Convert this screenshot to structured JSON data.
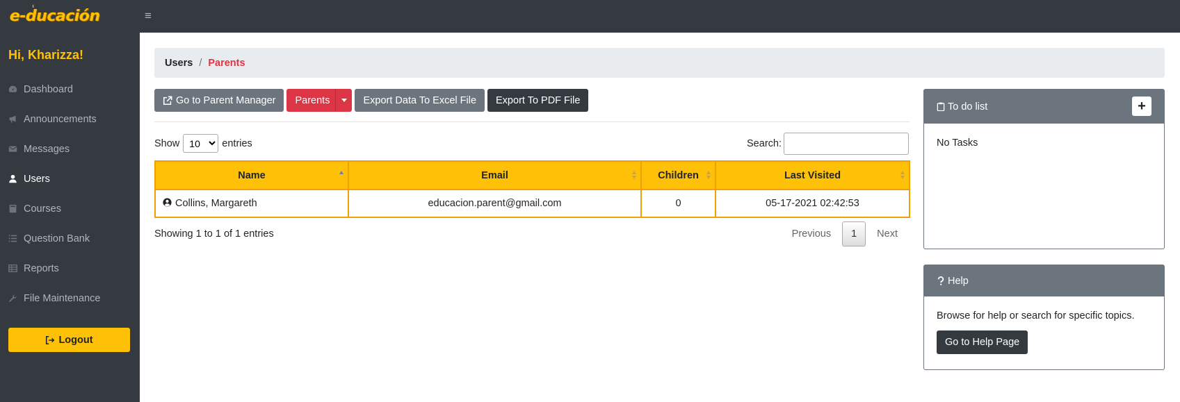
{
  "app": {
    "logo_text": "e-ducación",
    "greeting": "Hi, Kharizza!"
  },
  "sidebar": {
    "items": [
      {
        "label": "Dashboard",
        "icon": "dashboard-icon"
      },
      {
        "label": "Announcements",
        "icon": "bullhorn-icon"
      },
      {
        "label": "Messages",
        "icon": "envelope-icon"
      },
      {
        "label": "Users",
        "icon": "user-icon",
        "active": true
      },
      {
        "label": "Courses",
        "icon": "book-icon"
      },
      {
        "label": "Question Bank",
        "icon": "list-icon"
      },
      {
        "label": "Reports",
        "icon": "table-icon"
      },
      {
        "label": "File Maintenance",
        "icon": "wrench-icon"
      }
    ],
    "logout_label": "Logout"
  },
  "breadcrumb": {
    "root": "Users",
    "separator": "/",
    "current": "Parents"
  },
  "toolbar": {
    "parent_manager_label": "Go to Parent Manager",
    "parents_label": "Parents",
    "export_excel_label": "Export Data To Excel File",
    "export_pdf_label": "Export To PDF File"
  },
  "table_controls": {
    "show_label": "Show",
    "page_size": "10",
    "entries_label": "entries",
    "search_label": "Search:",
    "search_value": ""
  },
  "table": {
    "columns": [
      "Name",
      "Email",
      "Children",
      "Last Visited"
    ],
    "rows": [
      {
        "name": "Collins, Margareth",
        "email": "educacion.parent@gmail.com",
        "children": "0",
        "last_visited": "05-17-2021 02:42:53"
      }
    ]
  },
  "pagination": {
    "info": "Showing 1 to 1 of 1 entries",
    "previous": "Previous",
    "current": "1",
    "next": "Next"
  },
  "todo": {
    "title": "To do list",
    "add_label": "+",
    "empty_text": "No Tasks"
  },
  "help": {
    "title": "Help",
    "text": "Browse for help or search for specific topics.",
    "button_label": "Go to Help Page"
  },
  "colors": {
    "accent": "#ffc107",
    "sidebar": "#343a40",
    "danger": "#dc3545",
    "secondary": "#6c757d"
  }
}
